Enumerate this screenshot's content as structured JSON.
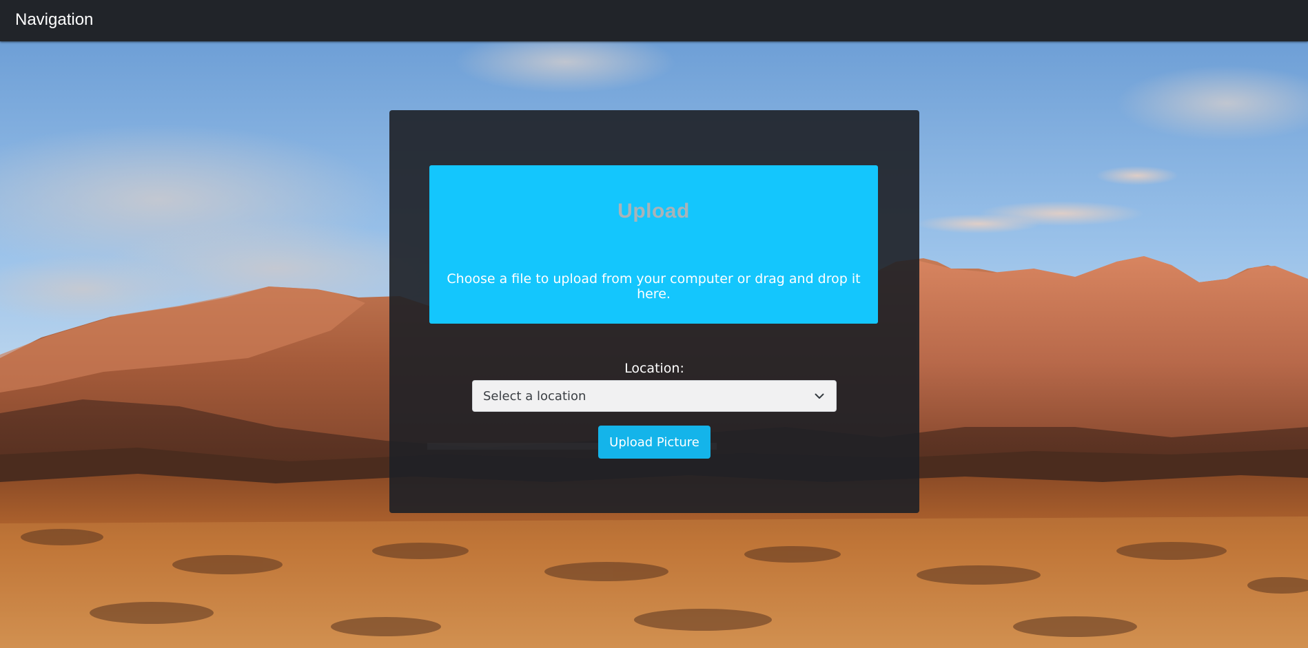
{
  "navbar": {
    "brand": "Navigation"
  },
  "upload_card": {
    "dropzone": {
      "title": "Upload",
      "hint": "Choose a file to upload from your computer or drag and drop it here."
    },
    "location": {
      "label": "Location:",
      "selected": "Select a location"
    },
    "submit_label": "Upload Picture"
  },
  "background": {
    "icon": "desert-mountain-landscape-photo"
  },
  "colors": {
    "navbar_bg": "#212429",
    "dropzone_bg": "#14c6fd",
    "button_bg": "#14b4ea",
    "card_bg": "#1e2026",
    "select_bg": "#f1f1f2"
  }
}
